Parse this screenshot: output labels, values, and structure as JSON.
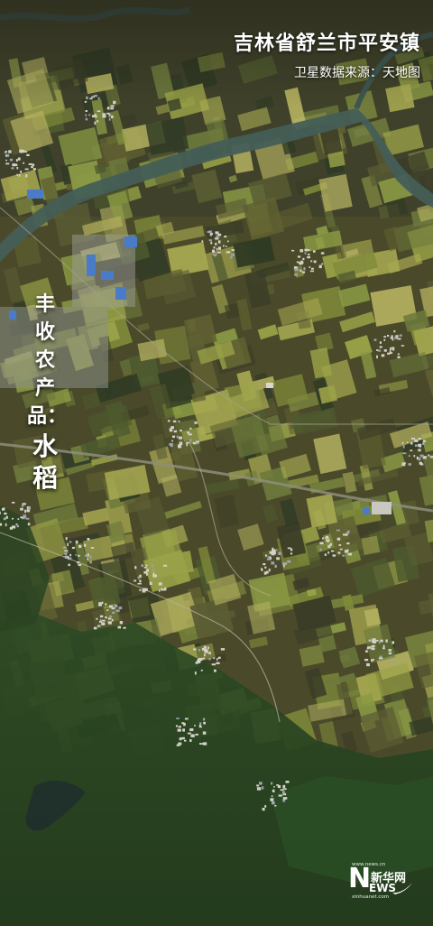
{
  "title": "吉林省舒兰市平安镇",
  "subtitle": "卫星数据来源：天地图",
  "side_label": "丰收农产品：",
  "crop": "水稻",
  "logo": {
    "url_top": "www.news.cn",
    "n_letter": "N",
    "name_zh": "新华网",
    "ews": "EWS",
    "url_bottom": "xinhuanet.com"
  },
  "colors": {
    "text": "#ffffff",
    "river": "#3e5a5c",
    "field_yellow": "#9aa248",
    "field_dark": "#3b3c27",
    "forest": "#1f4020",
    "buildings_blue": "#4a7bc8"
  }
}
